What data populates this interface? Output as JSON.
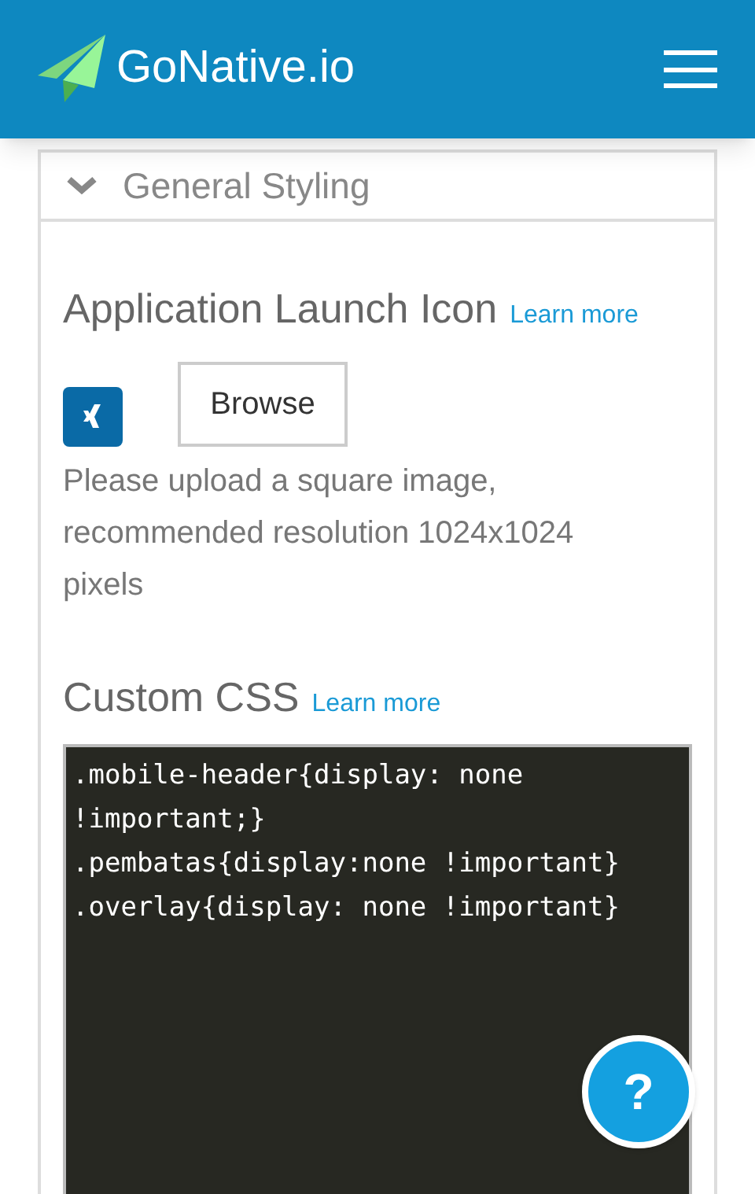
{
  "header": {
    "brand": "GoNative.io"
  },
  "panel": {
    "title": "General Styling",
    "expanded": true
  },
  "launch_icon": {
    "label": "Application Launch Icon",
    "link": "Learn more",
    "button": "Browse",
    "hint": "Please upload a square image, recommended resolution 1024x1024 pixels"
  },
  "custom_css": {
    "label": "Custom CSS",
    "link": "Learn more",
    "value": ".mobile-header{display: none !important;}\n.pembatas{display:none !important}\n.overlay{display: none !important}"
  },
  "help_button": {
    "label": "?"
  }
}
